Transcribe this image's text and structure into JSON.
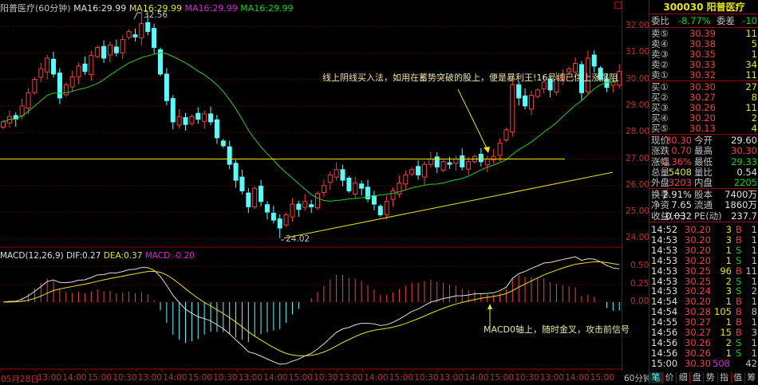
{
  "header": {
    "name": "阳普医疗(60分钟)",
    "ma": [
      "MA16:29.99",
      "MA16:29.99",
      "MA16:29.99",
      "MA16:29.99"
    ],
    "ma_colors": [
      "#e0e0e0",
      "#e8e800",
      "#e020e0",
      "#20e020"
    ]
  },
  "chart_data": {
    "type": "candlestick",
    "closes": [
      28.4,
      28.6,
      28.5,
      29.0,
      29.5,
      30.0,
      30.4,
      30.8,
      30.2,
      29.3,
      29.8,
      30.1,
      30.5,
      30.3,
      30.9,
      31.2,
      30.8,
      31.3,
      31.0,
      31.5,
      31.8,
      31.6,
      32.1,
      31.8,
      31.2,
      30.2,
      29.2,
      28.4,
      28.6,
      28.3,
      28.6,
      28.5,
      28.7,
      28.4,
      27.8,
      27.5,
      26.8,
      26.2,
      25.8,
      25.2,
      25.9,
      25.4,
      25.0,
      24.7,
      24.4,
      24.9,
      25.3,
      25.1,
      25.4,
      25.2,
      25.7,
      26.0,
      26.4,
      26.6,
      26.2,
      25.8,
      26.1,
      25.9,
      25.5,
      25.3,
      24.9,
      25.4,
      25.8,
      26.1,
      26.4,
      26.6,
      26.4,
      26.8,
      27.0,
      26.7,
      26.9,
      26.8,
      27.0,
      26.7,
      26.9,
      27.1,
      26.9,
      27.0,
      27.1,
      27.6,
      28.1,
      29.8,
      29.3,
      29.0,
      29.4,
      29.6,
      29.9,
      29.6,
      30.0,
      30.2,
      30.4,
      30.6,
      29.5,
      30.8,
      30.5,
      30.0,
      29.7,
      29.9,
      30.3
    ],
    "high_label": "32.56",
    "low_label": "24.02",
    "high_value": 32.56,
    "low_value": 24.02,
    "price_ticks": [
      "32.00",
      "31.00",
      "30.00",
      "29.00",
      "28.00",
      "27.00",
      "26.00",
      "25.00",
      "24.00"
    ],
    "macd_ticks": [
      "0.50",
      "0.25",
      "0.00"
    ],
    "ma_period": 16,
    "support_level": 27.0,
    "trendline": [
      24.02,
      26.5
    ],
    "x_ticks": [
      "05月28日",
      "13:00",
      "14:00",
      "15:00",
      "10:30",
      "13:00",
      "14:00",
      "15:00",
      "10:30",
      "13:00",
      "14:00",
      "15:00",
      "10:30",
      "13:00",
      "14:00",
      "15:00",
      "10:30",
      "13:00",
      "14:00",
      "15:00",
      "10:30",
      "13:00",
      "14:00",
      "15:00"
    ]
  },
  "macd": {
    "label": "MACD(12,26,9)",
    "dif": "DIF:0.27",
    "dea": "DEA:0.37",
    "macd": "MACD:-0.20"
  },
  "annotations": {
    "top": "线上阴线买入法，如用在蓄势突破的股上，便是暴利王!16号线已供上涨强阻",
    "macd": "MACD0轴上，随时金叉，攻击前信号"
  },
  "period": "60分钟",
  "quote": {
    "title": "300030 阳普医疗",
    "weibi_label": "委比",
    "weibi": "-8.77%",
    "weicha_label": "委差",
    "weicha": "-10",
    "asks": [
      {
        "l": "卖⑤",
        "p": "30.39",
        "v": "11"
      },
      {
        "l": "卖④",
        "p": "30.38",
        "v": "5"
      },
      {
        "l": "卖③",
        "p": "30.35",
        "v": "1"
      },
      {
        "l": "卖②",
        "p": "30.33",
        "v": "34"
      },
      {
        "l": "卖①",
        "p": "30.32",
        "v": "11"
      }
    ],
    "bids": [
      {
        "l": "买①",
        "p": "30.30",
        "v": "27"
      },
      {
        "l": "买②",
        "p": "30.27",
        "v": "8"
      },
      {
        "l": "买③",
        "p": "30.26",
        "v": "11"
      },
      {
        "l": "买④",
        "p": "30.20",
        "v": "2"
      },
      {
        "l": "买⑤",
        "p": "30.13",
        "v": "4"
      }
    ],
    "stats": [
      {
        "l1": "现价",
        "v1": "30.30",
        "c1": "red",
        "l2": "今开",
        "v2": "29.60",
        "c2": "wht"
      },
      {
        "l1": "涨跌",
        "v1": "0.70",
        "c1": "red",
        "l2": "最高",
        "v2": "30.30",
        "c2": "red"
      },
      {
        "l1": "涨幅",
        "v1": "2.36%",
        "c1": "red",
        "l2": "最低",
        "v2": "29.33",
        "c2": "grn"
      },
      {
        "l1": "总量",
        "v1": "5408",
        "c1": "yel",
        "l2": "量比",
        "v2": "0.54",
        "c2": "wht"
      },
      {
        "l1": "外盘",
        "v1": "3203",
        "c1": "red",
        "l2": "内盘",
        "v2": "2205",
        "c2": "grn"
      }
    ],
    "fund": [
      {
        "l1": "换手",
        "v1": "2.91%",
        "l2": "股本",
        "v2": "7400万"
      },
      {
        "l1": "净资",
        "v1": "7.65",
        "l2": "流通",
        "v2": "1860万"
      },
      {
        "l1": "收益(一)",
        "v1": "0.032",
        "l2": "PE(动)",
        "v2": "237.7"
      }
    ],
    "ticks": [
      [
        "14:52",
        "30.20",
        "3",
        "B",
        "1"
      ],
      [
        "14:53",
        "30.20",
        "3",
        "B",
        "1"
      ],
      [
        "14:53",
        "30.20",
        "1",
        "S",
        "1"
      ],
      [
        "14:53",
        "30.20",
        "1",
        "S",
        "1"
      ],
      [
        "14:53",
        "30.25",
        "96",
        "B",
        "11"
      ],
      [
        "14:53",
        "30.25",
        "2",
        "S",
        "1"
      ],
      [
        "14:53",
        "30.24",
        "3",
        "S",
        "2"
      ],
      [
        "14:54",
        "30.20",
        "1",
        "B",
        "1"
      ],
      [
        "14:54",
        "30.28",
        "105",
        "B",
        "8"
      ],
      [
        "14:55",
        "30.27",
        "1",
        "B",
        "1"
      ],
      [
        "14:56",
        "30.27",
        "15",
        "B",
        "3"
      ],
      [
        "14:56",
        "30.26",
        "2",
        "S",
        "1"
      ],
      [
        "14:56",
        "30.26",
        "1",
        "S",
        "1"
      ],
      [
        "15:00",
        "30.30",
        "508",
        "",
        "42"
      ]
    ],
    "tabs": [
      "笔",
      "价",
      "细",
      "盘",
      "势",
      "指",
      "值",
      "筹"
    ]
  }
}
